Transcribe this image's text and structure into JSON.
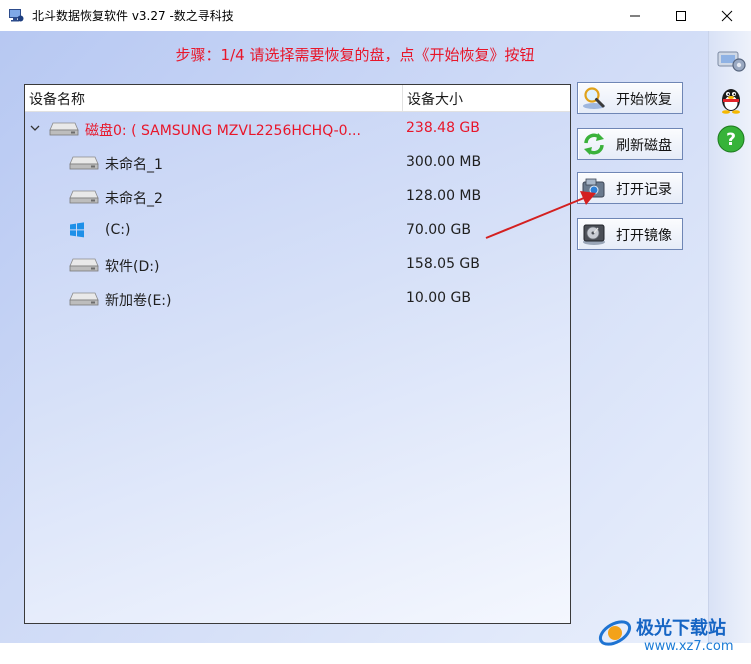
{
  "window": {
    "title": "北斗数据恢复软件 v3.27 -数之寻科技"
  },
  "step_text": "步骤：1/4 请选择需要恢复的盘，点《开始恢复》按钮",
  "table": {
    "columns": [
      "设备名称",
      "设备大小"
    ],
    "rows": [
      {
        "label": "磁盘0: ( SAMSUNG MZVL2256HCHQ-0...",
        "size": "238.48 GB",
        "icon": "hard-drive-icon",
        "level": 0
      },
      {
        "label": "未命名_1",
        "size": "300.00 MB",
        "icon": "drive-icon",
        "level": 1
      },
      {
        "label": "未命名_2",
        "size": "128.00 MB",
        "icon": "drive-icon",
        "level": 1
      },
      {
        "label": "(C:)",
        "size": "70.00 GB",
        "icon": "windows-logo-icon",
        "level": 1
      },
      {
        "label": "软件(D:)",
        "size": "158.05 GB",
        "icon": "drive-icon",
        "level": 1
      },
      {
        "label": "新加卷(E:)",
        "size": "10.00 GB",
        "icon": "drive-icon",
        "level": 1
      }
    ]
  },
  "buttons": {
    "start_recover": "开始恢复",
    "refresh_disk": "刷新磁盘",
    "open_record": "打开记录",
    "open_image": "打开镜像"
  },
  "sidebar": {
    "icons": [
      "settings-icon",
      "qq-penguin-icon",
      "help-icon"
    ]
  },
  "watermark": {
    "main": "极光下载站",
    "sub": "www.xz7.com"
  },
  "colors": {
    "step_red": "#e8162a",
    "arrow_red": "#d42020",
    "panel_border": "#3a3a3a"
  }
}
